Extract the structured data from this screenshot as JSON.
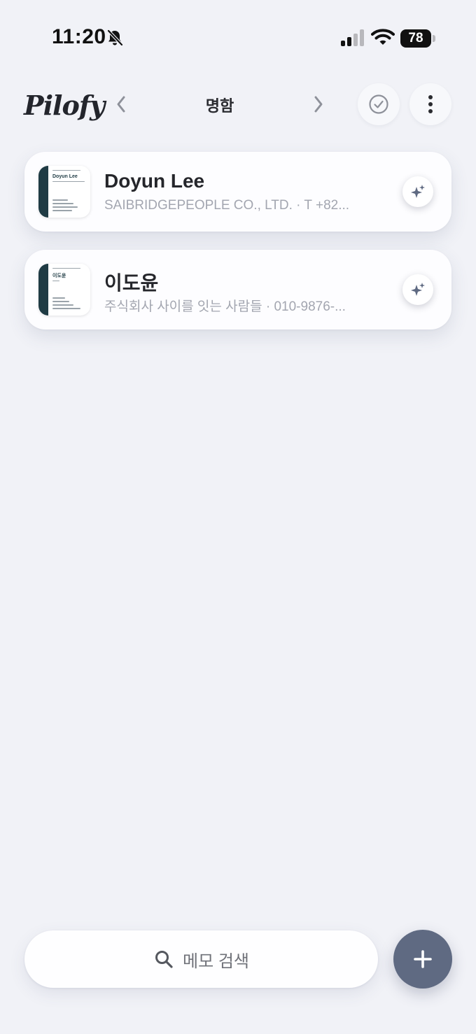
{
  "status_bar": {
    "time": "11:20",
    "battery": "78",
    "icons": [
      "bell-off-icon",
      "signal-icon",
      "wifi-icon",
      "battery-icon"
    ]
  },
  "header": {
    "logo": "Pilofy",
    "title": "명함",
    "prev_icon": "chevron-left-icon",
    "next_icon": "chevron-right-icon",
    "select_icon": "check-circle-icon",
    "more_icon": "more-vertical-icon"
  },
  "cards": [
    {
      "title": "Doyun Lee",
      "subtitle": "SAIBRIDGEPEOPLE CO., LTD. · T +82...",
      "thumbnail_name": "Doyun Lee",
      "ai_icon": "sparkle-icon"
    },
    {
      "title": "이도윤",
      "subtitle": "주식회사 사이를 잇는 사람들 · 010-9876-...",
      "thumbnail_name": "이도윤",
      "ai_icon": "sparkle-icon"
    }
  ],
  "search": {
    "placeholder": "메모 검색",
    "icon": "search-icon"
  },
  "fab": {
    "icon": "plus-icon"
  },
  "colors": {
    "background": "#f1f2f7",
    "fab": "#5f6a82",
    "thumbnail_accent": "#1f3b44",
    "subtitle_text": "#a3a6b0"
  }
}
